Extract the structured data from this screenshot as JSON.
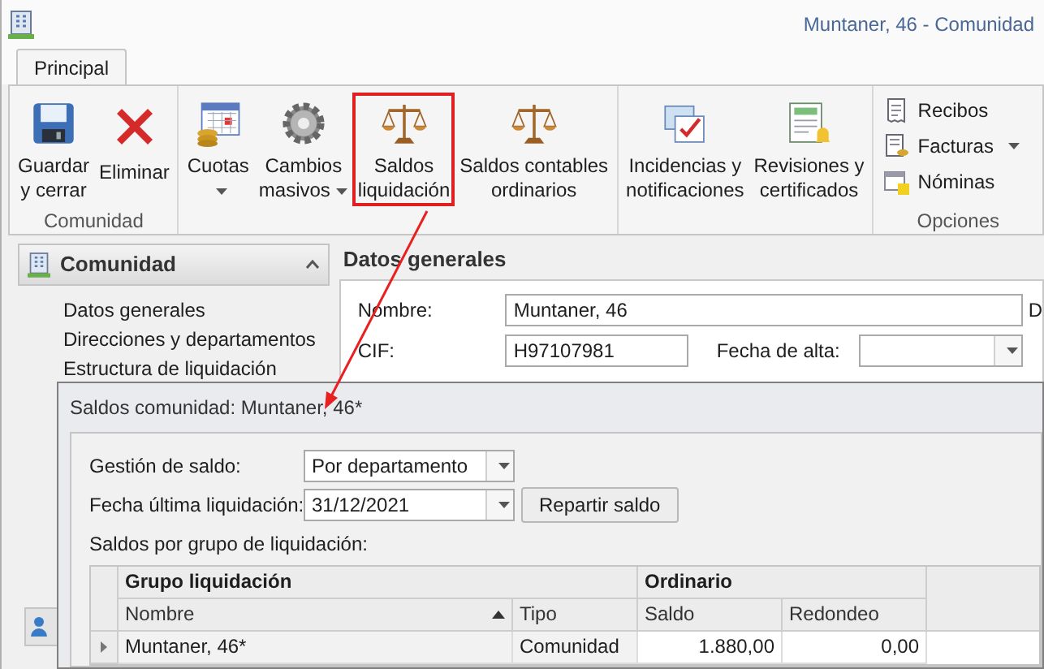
{
  "window": {
    "title": "Muntaner, 46 - Comunidad"
  },
  "ribbon": {
    "tabs": [
      {
        "label": "Principal",
        "selected": true
      }
    ],
    "groups": [
      {
        "label": "Comunidad",
        "buttons": [
          {
            "kind": "save",
            "lines": [
              "Guardar",
              "y cerrar"
            ],
            "dropdown": false,
            "highlighted": false
          },
          {
            "kind": "delete",
            "lines": [
              "Eliminar"
            ],
            "dropdown": false,
            "highlighted": false
          }
        ]
      },
      {
        "buttons": [
          {
            "kind": "calendar",
            "lines": [
              "Cuotas"
            ],
            "dropdown": true,
            "highlighted": false
          },
          {
            "kind": "gear",
            "lines": [
              "Cambios",
              "masivos"
            ],
            "dropdown": true,
            "highlighted": false
          },
          {
            "kind": "scales",
            "lines": [
              "Saldos",
              "liquidación"
            ],
            "dropdown": false,
            "highlighted": true
          },
          {
            "kind": "scales",
            "lines": [
              "Saldos contables",
              "ordinarios"
            ],
            "dropdown": false,
            "highlighted": false
          }
        ]
      },
      {
        "buttons": [
          {
            "kind": "mail",
            "lines": [
              "Incidencias y",
              "notificaciones"
            ],
            "dropdown": false,
            "highlighted": false
          },
          {
            "kind": "certificate",
            "lines": [
              "Revisiones y",
              "certificados"
            ],
            "dropdown": false,
            "highlighted": false
          }
        ]
      },
      {
        "label": "Opciones",
        "small": [
          {
            "kind": "receipt",
            "label": "Recibos",
            "dropdown": false
          },
          {
            "kind": "invoice",
            "label": "Facturas",
            "dropdown": true
          },
          {
            "kind": "payroll",
            "label": "Nóminas",
            "dropdown": false
          }
        ]
      }
    ]
  },
  "sidebar": {
    "title": "Comunidad",
    "expanded": true,
    "items": [
      "Datos generales",
      "Direcciones y departamentos",
      "Estructura de liquidación"
    ]
  },
  "general": {
    "title": "Datos generales",
    "fields": [
      {
        "label": "Nombre:",
        "value": "Muntaner, 46"
      },
      {
        "label": "CIF:",
        "value": "H97107981"
      }
    ],
    "date_label": "Fecha de alta:",
    "cut_label": "D"
  },
  "dialog": {
    "title": "Saldos comunidad: Muntaner, 46*",
    "fields": [
      {
        "label": "Gestión de saldo:",
        "value": "Por departamento"
      },
      {
        "label": "Fecha última liquidación:",
        "value": "31/12/2021"
      }
    ],
    "button": "Repartir saldo",
    "grid_label": "Saldos por grupo de liquidación:",
    "bands": [
      "Grupo liquidación",
      "Ordinario"
    ],
    "columns": [
      {
        "label": "Nombre",
        "sorted": true
      },
      {
        "label": "Tipo",
        "sorted": false
      },
      {
        "label": "Saldo",
        "sorted": false
      },
      {
        "label": "Redondeo",
        "sorted": false
      }
    ],
    "rows": [
      {
        "selected": true,
        "cells": [
          "Muntaner, 46*",
          "Comunidad",
          "1.880,00",
          "0,00"
        ]
      }
    ]
  }
}
